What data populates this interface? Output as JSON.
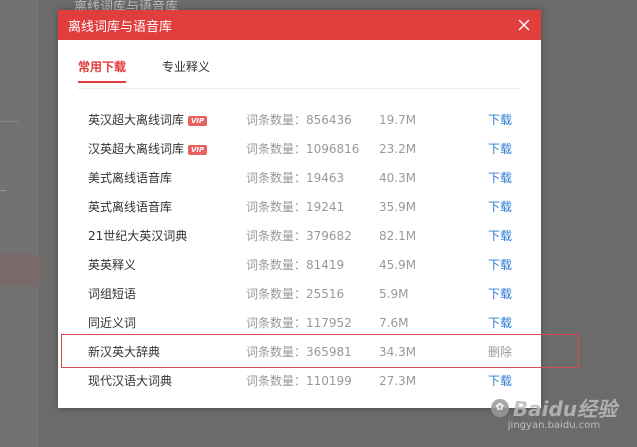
{
  "background": {
    "title_fragment": "离线词库与语音库"
  },
  "dialog": {
    "title": "离线词库与语音库",
    "close_icon": "close-icon",
    "tabs": [
      {
        "label": "常用下载",
        "active": true
      },
      {
        "label": "专业释义",
        "active": false
      }
    ],
    "rows": [
      {
        "name": "英汉超大离线词库",
        "vip": "VIP",
        "count": "词条数量：856436",
        "size": "19.7M",
        "action": "下载"
      },
      {
        "name": "汉英超大离线词库",
        "vip": "VIP",
        "count": "词条数量：1096816",
        "size": "23.2M",
        "action": "下载"
      },
      {
        "name": "美式离线语音库",
        "vip": "",
        "count": "词条数量：19463",
        "size": "40.3M",
        "action": "下载"
      },
      {
        "name": "英式离线语音库",
        "vip": "",
        "count": "词条数量：19241",
        "size": "35.9M",
        "action": "下载"
      },
      {
        "name": "21世纪大英汉词典",
        "vip": "",
        "count": "词条数量：379682",
        "size": "82.1M",
        "action": "下载"
      },
      {
        "name": "英英释义",
        "vip": "",
        "count": "词条数量：81419",
        "size": "45.9M",
        "action": "下载"
      },
      {
        "name": "词组短语",
        "vip": "",
        "count": "词条数量：25516",
        "size": "5.9M",
        "action": "下载"
      },
      {
        "name": "同近义词",
        "vip": "",
        "count": "词条数量：117952",
        "size": "7.6M",
        "action": "下载"
      },
      {
        "name": "新汉英大辞典",
        "vip": "",
        "count": "词条数量：365981",
        "size": "34.3M",
        "action": "删除"
      },
      {
        "name": "现代汉语大词典",
        "vip": "",
        "count": "词条数量：110199",
        "size": "27.3M",
        "action": "下载"
      }
    ]
  },
  "watermark": {
    "brand": "Baidu经验",
    "url": "jingyan.baidu.com"
  },
  "colors": {
    "accent": "#e23d3d",
    "link": "#2b7bd6",
    "muted": "#999999"
  }
}
